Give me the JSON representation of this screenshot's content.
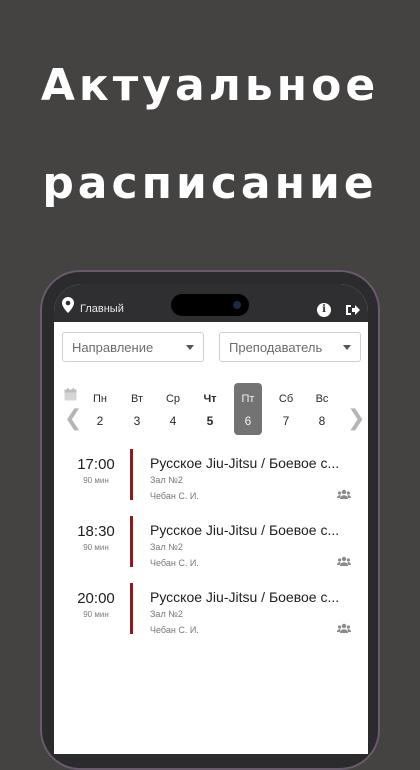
{
  "promo": {
    "line1": "Актуальное",
    "line2": "расписание"
  },
  "topbar": {
    "location_label": "Главный",
    "icons": [
      "location-pin-icon",
      "info-icon",
      "logout-icon"
    ]
  },
  "filters": {
    "direction_placeholder": "Направление",
    "teacher_placeholder": "Преподаватель"
  },
  "week": {
    "days": [
      {
        "name": "Пн",
        "date": "2"
      },
      {
        "name": "Вт",
        "date": "3"
      },
      {
        "name": "Ср",
        "date": "4"
      },
      {
        "name": "Чт",
        "date": "5"
      },
      {
        "name": "Пт",
        "date": "6"
      },
      {
        "name": "Сб",
        "date": "7"
      },
      {
        "name": "Вс",
        "date": "8"
      }
    ],
    "today": "Чт",
    "selected": "Пт"
  },
  "events": [
    {
      "time": "17:00",
      "duration": "90 мин",
      "title": "Русское Jiu-Jitsu / Боевое с...",
      "hall": "Зал №2",
      "coach": "Чебан С. И."
    },
    {
      "time": "18:30",
      "duration": "90 мин",
      "title": "Русское Jiu-Jitsu / Боевое с...",
      "hall": "Зал №2",
      "coach": "Чебан С. И."
    },
    {
      "time": "20:00",
      "duration": "90 мин",
      "title": "Русское Jiu-Jitsu / Боевое с...",
      "hall": "Зал №2",
      "coach": "Чебан С. И."
    }
  ],
  "colors": {
    "background": "#454242",
    "event_accent": "#8e1b1b",
    "selected_day": "#737373"
  }
}
